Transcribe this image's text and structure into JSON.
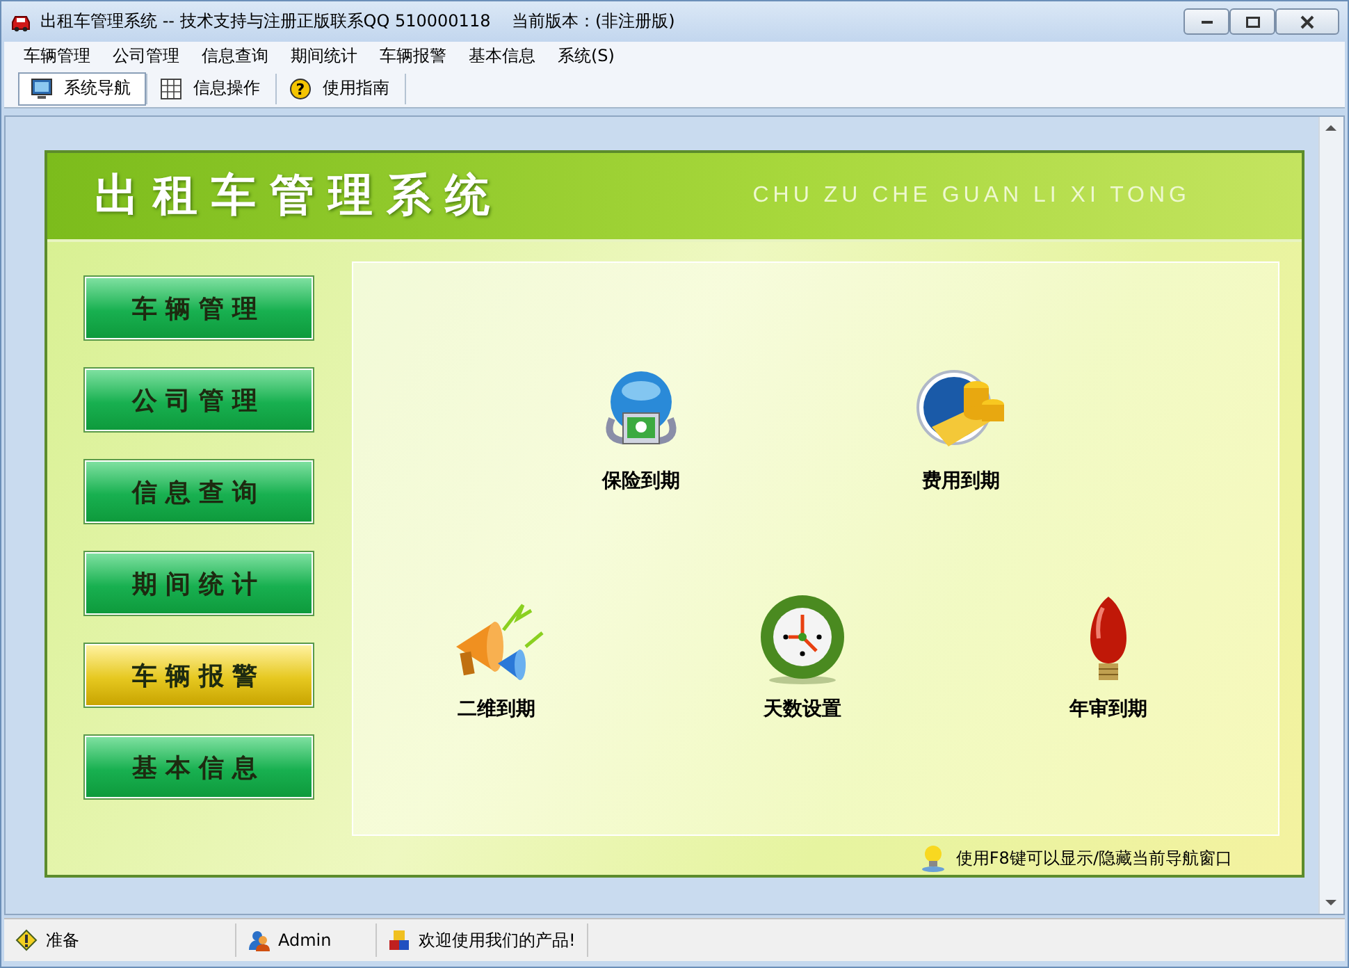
{
  "window": {
    "title": "出租车管理系统 -- 技术支持与注册正版联系QQ 510000118    当前版本：(非注册版)"
  },
  "menu": [
    "车辆管理",
    "公司管理",
    "信息查询",
    "期间统计",
    "车辆报警",
    "基本信息",
    "系统(S)"
  ],
  "toolbar": [
    {
      "label": "系统导航",
      "kind": "monitor",
      "selected": true
    },
    {
      "label": "信息操作",
      "kind": "grid",
      "selected": false
    },
    {
      "label": "使用指南",
      "kind": "help",
      "icon": "?",
      "selected": false
    }
  ],
  "header": {
    "title": "出租车管理系统",
    "subtitle": "CHU ZU CHE GUAN LI XI TONG"
  },
  "nav": [
    {
      "label": "车辆管理",
      "selected": false
    },
    {
      "label": "公司管理",
      "selected": false
    },
    {
      "label": "信息查询",
      "selected": false
    },
    {
      "label": "期间统计",
      "selected": false
    },
    {
      "label": "车辆报警",
      "selected": true
    },
    {
      "label": "基本信息",
      "selected": false
    }
  ],
  "functions": [
    [
      {
        "label": "保险到期",
        "kind": "globe"
      },
      {
        "label": "费用到期",
        "kind": "coins"
      }
    ],
    [
      {
        "label": "二维到期",
        "kind": "megaphone"
      },
      {
        "label": "天数设置",
        "kind": "clock"
      },
      {
        "label": "年审到期",
        "kind": "bulb"
      }
    ]
  ],
  "hint": "使用F8键可以显示/隐藏当前导航窗口",
  "status_bar": [
    {
      "text": "准备",
      "kind": "ready"
    },
    {
      "text": "Admin",
      "kind": "user"
    },
    {
      "text": "欢迎使用我们的产品!",
      "kind": "cubes"
    }
  ]
}
